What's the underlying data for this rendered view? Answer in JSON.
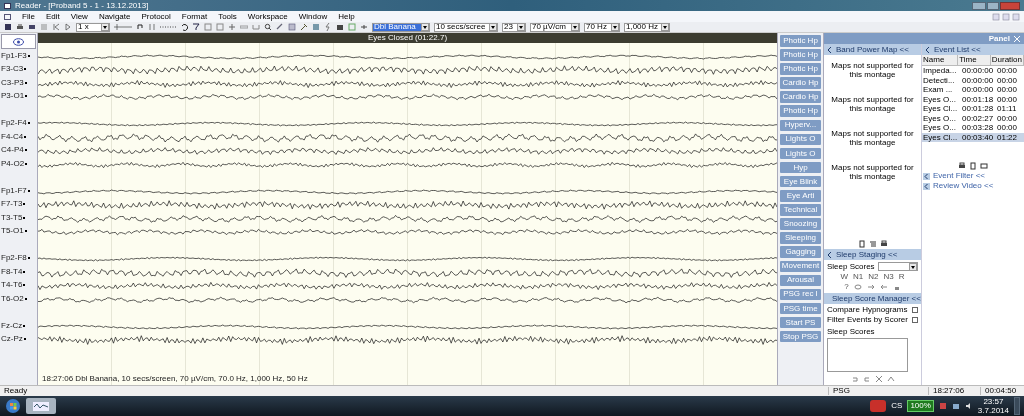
{
  "window": {
    "title": "Reader - [Proband 5 - 1 - 13.12.2013]"
  },
  "menu": [
    "File",
    "Edit",
    "View",
    "Navigate",
    "Protocol",
    "Format",
    "Tools",
    "Workspace",
    "Window",
    "Help"
  ],
  "toolbar": {
    "zoom": "1 x",
    "dropdowns": [
      {
        "value": "Dbl Banana",
        "focused": true
      },
      {
        "value": "10 secs/scree",
        "focused": false
      },
      {
        "value": "23",
        "focused": false
      },
      {
        "value": "70 µV/cm",
        "focused": false
      },
      {
        "value": "70 Hz",
        "focused": false
      },
      {
        "value": "1,000 Hz",
        "focused": false
      }
    ]
  },
  "eeg": {
    "event": "Eyes Closed (01:22.7)",
    "groups": [
      {
        "channels": [
          "Fp1-F3",
          "F3-C3",
          "C3-P3",
          "P3-O1"
        ]
      },
      {
        "channels": [
          "Fp2-F4",
          "F4-C4",
          "C4-P4",
          "P4-O2"
        ]
      },
      {
        "channels": [
          "Fp1-F7",
          "F7-T3",
          "T3-T5",
          "T5-O1"
        ]
      },
      {
        "channels": [
          "Fp2-F8",
          "F8-T4",
          "T4-T6",
          "T6-O2"
        ]
      },
      {
        "channels": [
          "Fz-Cz",
          "Cz-Pz"
        ]
      }
    ],
    "footer": "18:27:06 Dbl Banana, 10 secs/screen, 70 µV/cm, 70.0 Hz, 1,000 Hz, 50 Hz"
  },
  "event_buttons": [
    "Photic Hp",
    "Photic Hp",
    "Photic Hp",
    "Cardio Hp",
    "Cardio Hp",
    "Photic Hp",
    "Hyperv...",
    "Lights O",
    "Lights O",
    "Hyp",
    "Eye Blink",
    "Eye Arti",
    "Technical",
    "Snoozing",
    "Sleeping",
    "Gagging",
    "Movement",
    "Arousal",
    "PSG rec I",
    "PSG time",
    "Start PS",
    "Stop PSG"
  ],
  "panel": {
    "title": "Panel",
    "band_power_map": {
      "title": "Band Power Map <<",
      "messages": [
        "Maps not supported for this montage",
        "Maps not supported for this montage",
        "Maps not supported for this montage",
        "Maps not supported for this montage"
      ]
    },
    "event_list": {
      "title": "Event List <<",
      "columns": [
        "Name",
        "Time",
        "Duration"
      ],
      "rows": [
        {
          "name": "Impeda...",
          "time": "00:00:00",
          "duration": "00:00",
          "selected": false
        },
        {
          "name": "Detecti...",
          "time": "00:00:00",
          "duration": "00:00",
          "selected": false
        },
        {
          "name": "Exam ...",
          "time": "00:00:00",
          "duration": "00:00",
          "selected": false
        },
        {
          "name": "Eyes O...",
          "time": "00:01:18",
          "duration": "00:00",
          "selected": false
        },
        {
          "name": "Eyes Cl...",
          "time": "00:01:28",
          "duration": "01:11",
          "selected": false
        },
        {
          "name": "Eyes O...",
          "time": "00:02:27",
          "duration": "00:00",
          "selected": false
        },
        {
          "name": "Eyes O...",
          "time": "00:03:28",
          "duration": "00:00",
          "selected": false
        },
        {
          "name": "Eyes Cl...",
          "time": "00:03:40",
          "duration": "01:22",
          "selected": true
        }
      ]
    },
    "links": [
      "Event Filter <<",
      "Review Video <<"
    ],
    "sleep_staging": {
      "title": "Sleep Staging <<",
      "label": "Sleep Scores",
      "stages": [
        "W",
        "N1",
        "N2",
        "N3",
        "R"
      ],
      "help": "?"
    },
    "sleep_score_manager": {
      "title": "Sleep Score Manager <<",
      "options": [
        {
          "label": "Compare Hypnograms",
          "checked": false
        },
        {
          "label": "Filter Events by Scorer",
          "checked": false
        }
      ],
      "list_label": "Sleep Scores"
    }
  },
  "status_bar": {
    "left": "Ready",
    "sections": [
      "PSG",
      "18:27:06",
      "00:04:50"
    ]
  },
  "taskbar": {
    "battery": "100%",
    "language": "CS",
    "time": "23:57",
    "date": "3.7.2014"
  }
}
